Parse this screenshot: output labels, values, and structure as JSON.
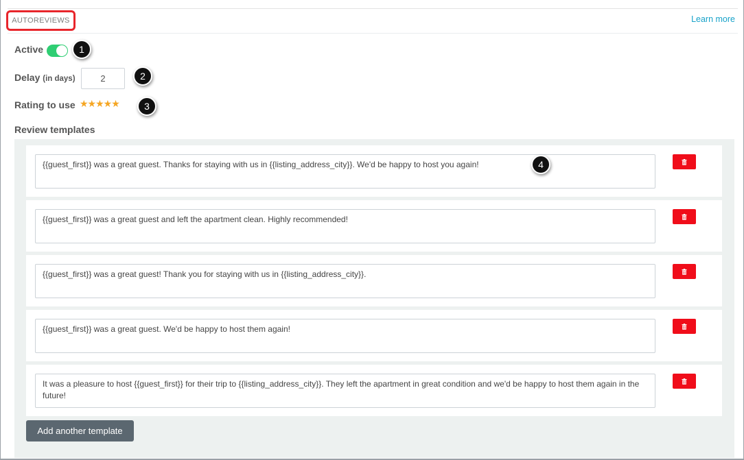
{
  "section": {
    "title": "AUTOREVIEWS",
    "learn_more": "Learn more"
  },
  "active": {
    "label": "Active",
    "enabled": true
  },
  "delay": {
    "label": "Delay",
    "hint": "(in days)",
    "value": "2"
  },
  "rating": {
    "label": "Rating to use",
    "stars": "★★★★★",
    "value": 5,
    "max": 5
  },
  "templates": {
    "heading": "Review templates",
    "items": [
      {
        "text": "{{guest_first}} was a great guest. Thanks for staying with us in {{listing_address_city}}. We'd be happy to host you again!"
      },
      {
        "text": "{{guest_first}} was a great guest and left the apartment clean. Highly recommended!"
      },
      {
        "text": "{{guest_first}} was a great guest! Thank you for staying with us in {{listing_address_city}}."
      },
      {
        "text": "{{guest_first}} was a great guest. We'd be happy to host them again!"
      },
      {
        "text": "It was a pleasure to host {{guest_first}} for their trip to {{listing_address_city}}. They left the apartment in great condition and we'd be happy to host them again in the future!"
      }
    ],
    "add_label": "Add another template"
  },
  "callouts": [
    "1",
    "2",
    "3",
    "4"
  ],
  "colors": {
    "accent_red": "#f00d1a",
    "toggle_green": "#2fce73",
    "link": "#17a2c9",
    "star": "#f5a623"
  },
  "icons": {
    "delete": "trash-icon"
  }
}
